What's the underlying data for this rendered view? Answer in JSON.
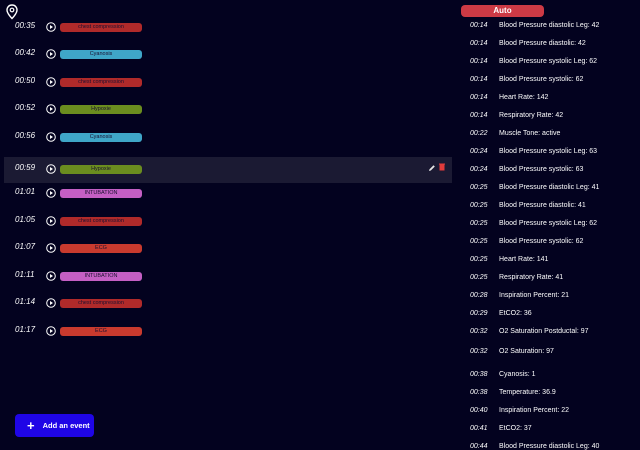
{
  "colors": {
    "background": "#03021f",
    "selected_row": "#1b1a33",
    "chest_compression": "#b02a2a",
    "cyanosis": "#3fa6c8",
    "hypoxia": "#6b8d1f",
    "intubation": "#c45fc4",
    "ecg": "#c93a2e",
    "add_button": "#1f05e6",
    "auto_badge": "#cd3a45"
  },
  "events": [
    {
      "time": "00:35",
      "label": "chest compression",
      "color": "#b02a2a",
      "selected": false
    },
    {
      "time": "00:42",
      "label": "Cyanosis",
      "color": "#3fa6c8",
      "selected": false
    },
    {
      "time": "00:50",
      "label": "chest compression",
      "color": "#b02a2a",
      "selected": false
    },
    {
      "time": "00:52",
      "label": "Hypoxie",
      "color": "#6b8d1f",
      "selected": false
    },
    {
      "time": "00:56",
      "label": "Cyanosis",
      "color": "#3fa6c8",
      "selected": false
    },
    {
      "time": "00:59",
      "label": "Hypoxie",
      "color": "#6b8d1f",
      "selected": true
    },
    {
      "time": "01:01",
      "label": "INTUBATION",
      "color": "#c45fc4",
      "selected": false
    },
    {
      "time": "01:05",
      "label": "chest compression",
      "color": "#b02a2a",
      "selected": false
    },
    {
      "time": "01:07",
      "label": "ECG",
      "color": "#c93a2e",
      "selected": false
    },
    {
      "time": "01:11",
      "label": "INTUBATION",
      "color": "#c45fc4",
      "selected": false
    },
    {
      "time": "01:14",
      "label": "chest compression",
      "color": "#b02a2a",
      "selected": false
    },
    {
      "time": "01:17",
      "label": "ECG",
      "color": "#c93a2e",
      "selected": false
    }
  ],
  "add_button": {
    "label": "Add an event",
    "icon": "plus-icon"
  },
  "auto_badge": {
    "label": "Auto"
  },
  "log": [
    {
      "time": "00:14",
      "text": "Blood Pressure diastolic Leg: 42"
    },
    {
      "time": "00:14",
      "text": "Blood Pressure diastolic: 42"
    },
    {
      "time": "00:14",
      "text": "Blood Pressure systolic Leg: 62"
    },
    {
      "time": "00:14",
      "text": "Blood Pressure systolic: 62"
    },
    {
      "time": "00:14",
      "text": "Heart Rate: 142"
    },
    {
      "time": "00:14",
      "text": "Respiratory Rate: 42"
    },
    {
      "time": "00:22",
      "text": "Muscle Tone: active"
    },
    {
      "time": "00:24",
      "text": "Blood Pressure systolic Leg: 63"
    },
    {
      "time": "00:24",
      "text": "Blood Pressure systolic: 63"
    },
    {
      "time": "00:25",
      "text": "Blood Pressure diastolic Leg: 41"
    },
    {
      "time": "00:25",
      "text": "Blood Pressure diastolic: 41"
    },
    {
      "time": "00:25",
      "text": "Blood Pressure systolic Leg: 62"
    },
    {
      "time": "00:25",
      "text": "Blood Pressure systolic: 62"
    },
    {
      "time": "00:25",
      "text": "Heart Rate: 141"
    },
    {
      "time": "00:25",
      "text": "Respiratory Rate: 41"
    },
    {
      "time": "00:28",
      "text": "Inspiration Percent: 21"
    },
    {
      "time": "00:29",
      "text": "EtCO2: 36"
    },
    {
      "time": "00:32",
      "text": "O2 Saturation Postductal: 97"
    },
    {
      "time": "00:32",
      "text": "O2 Saturation: 97"
    },
    {
      "time": "00:38",
      "text": "Cyanosis: 1"
    },
    {
      "time": "00:38",
      "text": "Temperature: 36.9"
    },
    {
      "time": "00:40",
      "text": "Inspiration Percent: 22"
    },
    {
      "time": "00:41",
      "text": "EtCO2: 37"
    },
    {
      "time": "00:44",
      "text": "Blood Pressure diastolic Leg: 40"
    }
  ]
}
